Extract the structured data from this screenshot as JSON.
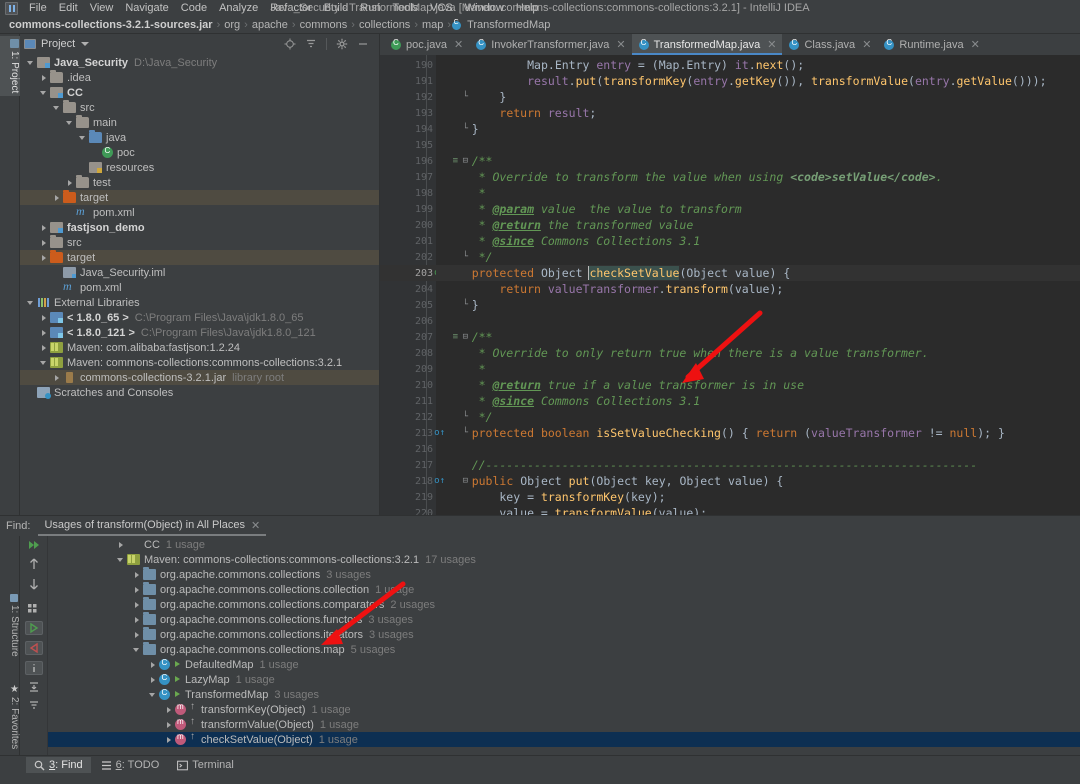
{
  "window": {
    "title": "Java_Security - TransformedMap.java [Maven: commons-collections:commons-collections:3.2.1] - IntelliJ IDEA"
  },
  "menubar": {
    "items": [
      "File",
      "Edit",
      "View",
      "Navigate",
      "Code",
      "Analyze",
      "Refactor",
      "Build",
      "Run",
      "Tools",
      "VCS",
      "Window",
      "Help"
    ]
  },
  "breadcrumb": {
    "root": "commons-collections-3.2.1-sources.jar",
    "parts": [
      "org",
      "apache",
      "commons",
      "collections",
      "map"
    ],
    "leaf": "TransformedMap"
  },
  "left_strip": {
    "project_tab": "1: Project",
    "structure_tab": "1: Structure",
    "favorites_tab": "2: Favorites"
  },
  "project_panel": {
    "title": "Project",
    "actions": [
      "locate-icon",
      "collapse-all-icon",
      "settings-icon",
      "hide-icon"
    ],
    "tree": [
      {
        "depth": 0,
        "arrow": "down",
        "icon": "module",
        "label": "Java_Security",
        "sub": "D:\\Java_Security",
        "bold": true,
        "hl": false
      },
      {
        "depth": 1,
        "arrow": "right",
        "icon": "folder",
        "label": ".idea",
        "sub": "",
        "bold": false,
        "hl": false
      },
      {
        "depth": 1,
        "arrow": "down",
        "icon": "module",
        "label": "CC",
        "sub": "",
        "bold": true,
        "hl": false
      },
      {
        "depth": 2,
        "arrow": "down",
        "icon": "folder",
        "label": "src",
        "sub": "",
        "bold": false,
        "hl": false
      },
      {
        "depth": 3,
        "arrow": "down",
        "icon": "folder",
        "label": "main",
        "sub": "",
        "bold": false,
        "hl": false
      },
      {
        "depth": 4,
        "arrow": "down",
        "icon": "folder-blue",
        "label": "java",
        "sub": "",
        "bold": false,
        "hl": false
      },
      {
        "depth": 5,
        "arrow": "none",
        "icon": "poc",
        "label": "poc",
        "sub": "",
        "bold": false,
        "hl": false
      },
      {
        "depth": 4,
        "arrow": "none",
        "icon": "module-src",
        "label": "resources",
        "sub": "",
        "bold": false,
        "hl": false
      },
      {
        "depth": 3,
        "arrow": "right",
        "icon": "folder",
        "label": "test",
        "sub": "",
        "bold": false,
        "hl": false
      },
      {
        "depth": 2,
        "arrow": "right",
        "icon": "folder-orange",
        "label": "target",
        "sub": "",
        "bold": false,
        "hl": true
      },
      {
        "depth": 3,
        "arrow": "none",
        "icon": "xml",
        "label": "pom.xml",
        "sub": "",
        "bold": false,
        "hl": false
      },
      {
        "depth": 1,
        "arrow": "right",
        "icon": "module",
        "label": "fastjson_demo",
        "sub": "",
        "bold": true,
        "hl": false
      },
      {
        "depth": 1,
        "arrow": "right",
        "icon": "folder",
        "label": "src",
        "sub": "",
        "bold": false,
        "hl": false
      },
      {
        "depth": 1,
        "arrow": "right",
        "icon": "folder-orange",
        "label": "target",
        "sub": "",
        "bold": false,
        "hl": true
      },
      {
        "depth": 2,
        "arrow": "none",
        "icon": "iml",
        "label": "Java_Security.iml",
        "sub": "",
        "bold": false,
        "hl": false
      },
      {
        "depth": 2,
        "arrow": "none",
        "icon": "xml",
        "label": "pom.xml",
        "sub": "",
        "bold": false,
        "hl": false
      },
      {
        "depth": 0,
        "arrow": "down",
        "icon": "libs",
        "label": "External Libraries",
        "sub": "",
        "bold": false,
        "hl": false
      },
      {
        "depth": 1,
        "arrow": "right",
        "icon": "jdk",
        "label": "< 1.8.0_65 >",
        "sub": "C:\\Program Files\\Java\\jdk1.8.0_65",
        "bold": true,
        "hl": false
      },
      {
        "depth": 1,
        "arrow": "right",
        "icon": "jdk",
        "label": "< 1.8.0_121 >",
        "sub": "C:\\Program Files\\Java\\jdk1.8.0_121",
        "bold": true,
        "hl": false
      },
      {
        "depth": 1,
        "arrow": "right",
        "icon": "maven",
        "label": "Maven: com.alibaba:fastjson:1.2.24",
        "sub": "",
        "bold": false,
        "hl": false
      },
      {
        "depth": 1,
        "arrow": "down",
        "icon": "maven",
        "label": "Maven: commons-collections:commons-collections:3.2.1",
        "sub": "",
        "bold": false,
        "hl": false
      },
      {
        "depth": 2,
        "arrow": "right",
        "icon": "jar",
        "label": "commons-collections-3.2.1.jar",
        "sub": "library root",
        "bold": false,
        "hl": true
      },
      {
        "depth": 0,
        "arrow": "none",
        "icon": "scratch",
        "label": "Scratches and Consoles",
        "sub": "",
        "bold": false,
        "hl": false
      }
    ]
  },
  "editor": {
    "tabs": [
      {
        "label": "poc.java",
        "icon": "java-class-green-icon",
        "active": false
      },
      {
        "label": "InvokerTransformer.java",
        "icon": "java-class-icon",
        "active": false
      },
      {
        "label": "TransformedMap.java",
        "icon": "java-class-icon",
        "active": true
      },
      {
        "label": "Class.java",
        "icon": "java-class-icon",
        "active": false
      },
      {
        "label": "Runtime.java",
        "icon": "java-class-icon",
        "active": false
      }
    ],
    "first_line_number": 190,
    "current_line": 203,
    "lines": [
      {
        "n": 190,
        "text": "            Map.Entry entry = (Map.Entry) it.next();"
      },
      {
        "n": 191,
        "text": "            result.put(transformKey(entry.getKey()), transformValue(entry.getValue()));"
      },
      {
        "n": 192,
        "text": "        }"
      },
      {
        "n": 193,
        "text": "        return result;"
      },
      {
        "n": 194,
        "text": "    }"
      },
      {
        "n": 195,
        "text": ""
      },
      {
        "n": 196,
        "text": "    /**"
      },
      {
        "n": 197,
        "text": "     * Override to transform the value when using <code>setValue</code>."
      },
      {
        "n": 198,
        "text": "     *"
      },
      {
        "n": 199,
        "text": "     * @param value  the value to transform"
      },
      {
        "n": 200,
        "text": "     * @return the transformed value"
      },
      {
        "n": 201,
        "text": "     * @since Commons Collections 3.1"
      },
      {
        "n": 202,
        "text": "     */"
      },
      {
        "n": 203,
        "text": "    protected Object checkSetValue(Object value) {"
      },
      {
        "n": 204,
        "text": "        return valueTransformer.transform(value);"
      },
      {
        "n": 205,
        "text": "    }"
      },
      {
        "n": 206,
        "text": ""
      },
      {
        "n": 207,
        "text": "    /**"
      },
      {
        "n": 208,
        "text": "     * Override to only return true when there is a value transformer."
      },
      {
        "n": 209,
        "text": "     *"
      },
      {
        "n": 210,
        "text": "     * @return true if a value transformer is in use"
      },
      {
        "n": 211,
        "text": "     * @since Commons Collections 3.1"
      },
      {
        "n": 212,
        "text": "     */"
      },
      {
        "n": 213,
        "text": "    protected boolean isSetValueChecking() { return (valueTransformer != null); }"
      },
      {
        "n": 216,
        "text": ""
      },
      {
        "n": 217,
        "text": "    //-----------------------------------------------------------------------"
      },
      {
        "n": 218,
        "text": "    public Object put(Object key, Object value) {"
      },
      {
        "n": 219,
        "text": "        key = transformKey(key);"
      },
      {
        "n": 220,
        "text": "        value = transformValue(value);"
      }
    ]
  },
  "find_panel": {
    "label": "Find:",
    "tab_title": "Usages of transform(Object) in All Places",
    "tools": [
      "rerun-icon",
      "prev-occurrence-icon",
      "next-occurrence-icon",
      "group-by-icon",
      "expand-all-icon",
      "collapse-all-icon",
      "export-icon",
      "settings-info-icon",
      "autoscroll-icon",
      "filter-icon",
      "more-icon"
    ],
    "results": [
      {
        "depth": 1,
        "arrow": "right",
        "icon": "module",
        "label": "CC",
        "count": "1 usage",
        "sel": false
      },
      {
        "depth": 1,
        "arrow": "down",
        "icon": "mvn",
        "label": "Maven: commons-collections:commons-collections:3.2.1",
        "count": "17 usages",
        "sel": false
      },
      {
        "depth": 2,
        "arrow": "right",
        "icon": "pkg",
        "label": "org.apache.commons.collections",
        "count": "3 usages",
        "sel": false
      },
      {
        "depth": 2,
        "arrow": "right",
        "icon": "pkg",
        "label": "org.apache.commons.collections.collection",
        "count": "1 usage",
        "sel": false
      },
      {
        "depth": 2,
        "arrow": "right",
        "icon": "pkg",
        "label": "org.apache.commons.collections.comparators",
        "count": "2 usages",
        "sel": false
      },
      {
        "depth": 2,
        "arrow": "right",
        "icon": "pkg",
        "label": "org.apache.commons.collections.functors",
        "count": "3 usages",
        "sel": false
      },
      {
        "depth": 2,
        "arrow": "right",
        "icon": "pkg",
        "label": "org.apache.commons.collections.iterators",
        "count": "3 usages",
        "sel": false
      },
      {
        "depth": 2,
        "arrow": "down",
        "icon": "pkg",
        "label": "org.apache.commons.collections.map",
        "count": "5 usages",
        "sel": false
      },
      {
        "depth": 3,
        "arrow": "right",
        "icon": "cls",
        "overlay": "green",
        "label": "DefaultedMap",
        "count": "1 usage",
        "sel": false
      },
      {
        "depth": 3,
        "arrow": "right",
        "icon": "cls",
        "overlay": "green",
        "label": "LazyMap",
        "count": "1 usage",
        "sel": false
      },
      {
        "depth": 3,
        "arrow": "down",
        "icon": "cls",
        "overlay": "green",
        "label": "TransformedMap",
        "count": "3 usages",
        "sel": false
      },
      {
        "depth": 4,
        "arrow": "right",
        "icon": "mth",
        "overlay": "up",
        "label": "transformKey(Object)",
        "count": "1 usage",
        "sel": false
      },
      {
        "depth": 4,
        "arrow": "right",
        "icon": "mth",
        "overlay": "up",
        "label": "transformValue(Object)",
        "count": "1 usage",
        "sel": false
      },
      {
        "depth": 4,
        "arrow": "right",
        "icon": "mth",
        "overlay": "up",
        "label": "checkSetValue(Object)",
        "count": "1 usage",
        "sel": true
      }
    ]
  },
  "statusbar": {
    "items": [
      {
        "label": "3: Find",
        "icon": "search-icon",
        "selected": true
      },
      {
        "label": "6: TODO",
        "icon": "list-icon",
        "selected": false
      },
      {
        "label": "Terminal",
        "icon": "terminal-icon",
        "selected": false
      }
    ]
  },
  "colors": {
    "accent": "#4a88c7",
    "selection": "#0d2f52",
    "highlight_row": "#4f4b41",
    "arrow_annotation": "#ee1111"
  }
}
